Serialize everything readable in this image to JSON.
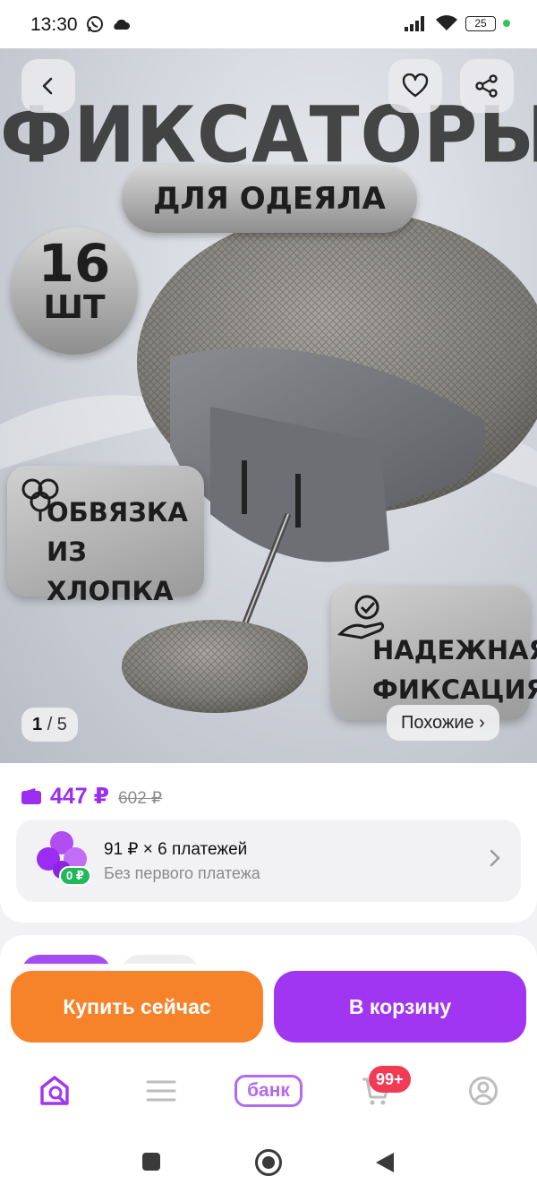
{
  "status_bar": {
    "time": "13:30",
    "battery": "25",
    "icons": [
      "whatsapp-icon",
      "cloud-icon",
      "signal-icon",
      "wifi-icon",
      "battery-icon"
    ]
  },
  "hero": {
    "title": "ФИКСАТОРЫ",
    "subtitle": "ДЛЯ ОДЕЯЛА",
    "count_number": "16",
    "count_unit": "ШТ",
    "feature_cotton_line1": "ОБВЯЗКА",
    "feature_cotton_line2": "ИЗ ХЛОПКА",
    "feature_fix_line1": "НАДЕЖНАЯ",
    "feature_fix_line2": "ФИКСАЦИЯ",
    "counter_current": "1",
    "counter_total": "/ 5",
    "similar_label": "Похожие ›"
  },
  "price": {
    "current": "447 ₽",
    "old": "602 ₽",
    "accent_color": "#9b2df0"
  },
  "installment": {
    "title": "91 ₽ × 6 платежей",
    "subtitle": "Без первого платежа",
    "badge": "0 ₽"
  },
  "actions": {
    "buy_now": "Купить сейчас",
    "add_to_cart": "В корзину",
    "buy_color": "#f6822a",
    "cart_color": "#a035f2"
  },
  "bottom_nav": {
    "bank_label": "банк",
    "cart_badge": "99+",
    "items": [
      "home-search-icon",
      "catalog-menu-icon",
      "bank-tab",
      "cart-icon",
      "profile-icon"
    ]
  }
}
